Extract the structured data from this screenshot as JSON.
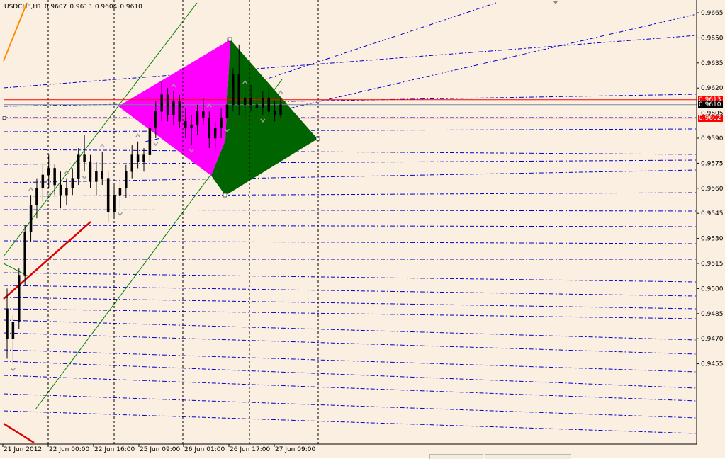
{
  "window": {
    "symbol": "USDCHF,H1",
    "ohlc": [
      "0.9607",
      "0.9613",
      "0.9604",
      "0.9610"
    ]
  },
  "price_axis": {
    "labels": [
      "0.9665",
      "0.9650",
      "0.9635",
      "0.9620",
      "0.9605",
      "0.9590",
      "0.9575",
      "0.9560",
      "0.9545",
      "0.9530",
      "0.9515",
      "0.9500",
      "0.9485",
      "0.9470",
      "0.9455"
    ],
    "tags": [
      {
        "value": "0.9613",
        "color": "#ff0000"
      },
      {
        "value": "0.9610",
        "color": "#000000"
      },
      {
        "value": "0.9602",
        "color": "#ff0000"
      }
    ]
  },
  "time_axis": {
    "labels": [
      "21 Jun 2012",
      "22 Jun 00:00",
      "22 Jun 16:00",
      "25 Jun 09:00",
      "26 Jun 01:00",
      "26 Jun 17:00",
      "27 Jun 09:00"
    ]
  },
  "colors": {
    "background": "#fbefe2",
    "candle": "#000000",
    "grid": "#000000",
    "fib_lines": "#0000cc",
    "channel": "#008000",
    "triangle_left": "#ff00ff",
    "triangle_right": "#006400",
    "support_resistance": "#ff0000",
    "trend_red": "#dd0000",
    "trend_orange": "#ff8c00"
  },
  "chart_data": {
    "type": "candlestick",
    "series": [
      {
        "ohlc": [
          [
            0.9488,
            0.95,
            0.9458,
            0.947
          ],
          [
            0.947,
            0.9484,
            0.9455,
            0.948
          ],
          [
            0.948,
            0.9512,
            0.9476,
            0.9508
          ],
          [
            0.9508,
            0.9538,
            0.9502,
            0.9534
          ],
          [
            0.9534,
            0.9556,
            0.9528,
            0.955
          ],
          [
            0.955,
            0.9566,
            0.9542,
            0.956
          ],
          [
            0.956,
            0.9575,
            0.9552,
            0.9568
          ],
          [
            0.9568,
            0.958,
            0.956,
            0.9572
          ],
          [
            0.9572,
            0.9574,
            0.9556,
            0.9562
          ],
          [
            0.9562,
            0.957,
            0.9548,
            0.9556
          ],
          [
            0.9556,
            0.9566,
            0.955,
            0.956
          ],
          [
            0.956,
            0.9572,
            0.9556,
            0.9566
          ],
          [
            0.9566,
            0.9584,
            0.9562,
            0.958
          ],
          [
            0.958,
            0.9592,
            0.957,
            0.9576
          ],
          [
            0.9576,
            0.958,
            0.956,
            0.9564
          ],
          [
            0.9564,
            0.9576,
            0.9556,
            0.957
          ],
          [
            0.957,
            0.9582,
            0.9562,
            0.9566
          ],
          [
            0.9566,
            0.957,
            0.954,
            0.9546
          ],
          [
            0.9546,
            0.9562,
            0.9542,
            0.9556
          ],
          [
            0.9556,
            0.9566,
            0.9548,
            0.956
          ],
          [
            0.956,
            0.9574,
            0.9554,
            0.957
          ],
          [
            0.957,
            0.9586,
            0.9566,
            0.958
          ],
          [
            0.958,
            0.9588,
            0.9572,
            0.9576
          ],
          [
            0.9576,
            0.9584,
            0.957,
            0.958
          ],
          [
            0.958,
            0.96,
            0.9576,
            0.9596
          ],
          [
            0.9596,
            0.9612,
            0.959,
            0.9606
          ],
          [
            0.9606,
            0.9624,
            0.96,
            0.9616
          ],
          [
            0.9616,
            0.962,
            0.96,
            0.9604
          ],
          [
            0.9604,
            0.9618,
            0.9598,
            0.9612
          ],
          [
            0.9612,
            0.9616,
            0.9596,
            0.96
          ],
          [
            0.96,
            0.9608,
            0.959,
            0.9596
          ],
          [
            0.9596,
            0.9604,
            0.9586,
            0.9598
          ],
          [
            0.9598,
            0.961,
            0.9592,
            0.9606
          ],
          [
            0.9606,
            0.9614,
            0.9598,
            0.9602
          ],
          [
            0.9602,
            0.9606,
            0.9584,
            0.959
          ],
          [
            0.959,
            0.96,
            0.9582,
            0.9596
          ],
          [
            0.9596,
            0.9608,
            0.959,
            0.9602
          ],
          [
            0.9602,
            0.9616,
            0.9598,
            0.961
          ],
          [
            0.961,
            0.9632,
            0.9606,
            0.9628
          ],
          [
            0.9628,
            0.9646,
            0.9604,
            0.961
          ],
          [
            0.961,
            0.962,
            0.9602,
            0.9614
          ],
          [
            0.9614,
            0.9622,
            0.9606,
            0.961
          ],
          [
            0.961,
            0.9616,
            0.9602,
            0.9608
          ],
          [
            0.9608,
            0.9618,
            0.9604,
            0.9614
          ],
          [
            0.9614,
            0.962,
            0.9604,
            0.9606
          ],
          [
            0.9606,
            0.9612,
            0.96,
            0.9604
          ],
          [
            0.9604,
            0.9614,
            0.9602,
            0.961
          ]
        ]
      }
    ],
    "x_labels": [
      "21 Jun 2012",
      "22 Jun 00:00",
      "22 Jun 16:00",
      "25 Jun 09:00",
      "26 Jun 01:00",
      "26 Jun 17:00",
      "27 Jun 09:00"
    ],
    "ylim": [
      0.945,
      0.9672
    ],
    "horizontal_levels": [
      0.9613,
      0.961,
      0.9602
    ]
  }
}
